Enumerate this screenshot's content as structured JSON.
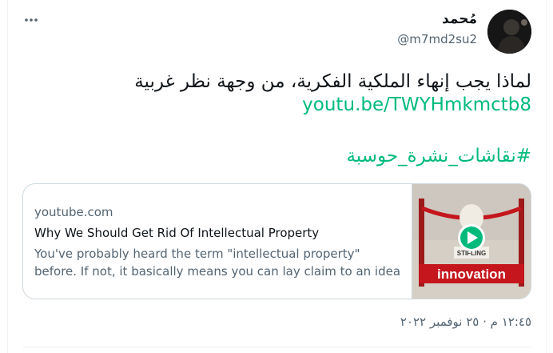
{
  "author": {
    "display_name": "مُحمد",
    "handle": "@m7md2su2"
  },
  "tweet": {
    "text": "لماذا يجب إنهاء الملكية الفكرية، من وجهة نظر غربية",
    "link": "youtu.be/TWYHmkmctb8",
    "hashtag": "#نقاشات_نشرة_حوسبة",
    "timestamp": "١٢:٤٥ م · ٢٥ نوفمبر ٢٠٢٢"
  },
  "link_card": {
    "domain": "youtube.com",
    "title": "Why We Should Get Rid Of Intellectual Property",
    "description": "You've probably heard the term \"intellectual property\" before. If not, it basically means you can lay claim to an idea and …",
    "thumbnail_text": {
      "sign": "STIFLING",
      "banner": "innovation"
    }
  },
  "icons": {
    "more": "more-horizontal-icon",
    "play": "play-icon"
  },
  "colors": {
    "accent": "#00ba7c",
    "secondary_text": "#536471",
    "border": "#cfd9de",
    "banner_red": "#c4161c"
  }
}
